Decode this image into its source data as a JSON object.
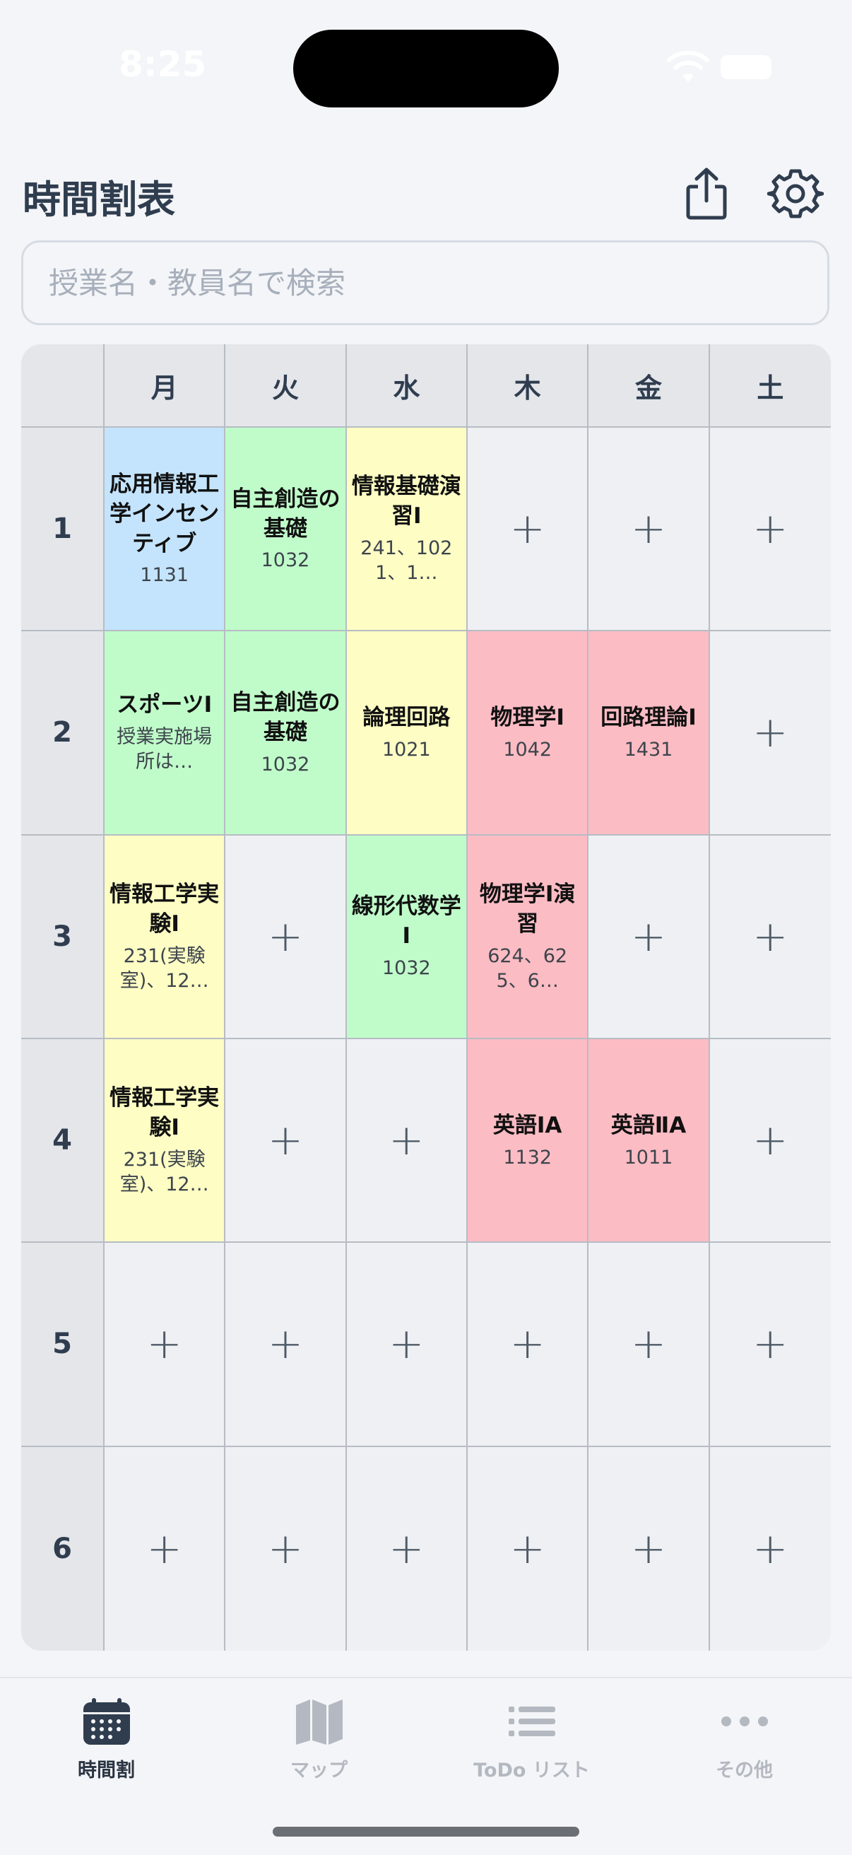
{
  "status_bar": {
    "time": "8:25"
  },
  "header": {
    "title": "時間割表"
  },
  "search": {
    "placeholder": "授業名・教員名で検索",
    "value": ""
  },
  "timetable": {
    "days": [
      "月",
      "火",
      "水",
      "木",
      "金",
      "土"
    ],
    "periods": [
      "1",
      "2",
      "3",
      "4",
      "5",
      "6"
    ],
    "add_symbol": "+",
    "slots": [
      [
        {
          "name": "応用情報工学インセンティブ",
          "room": "1131",
          "color": "#c4e4fd"
        },
        {
          "name": "自主創造の基礎",
          "room": "1032",
          "color": "#c0fcca"
        },
        {
          "name": "情報基礎演習Ⅰ",
          "room": "241、1021、1…",
          "color": "#fdfdc4"
        },
        null,
        null,
        null
      ],
      [
        {
          "name": "スポーツⅠ",
          "room": "授業実施場所は…",
          "color": "#c0fcca"
        },
        {
          "name": "自主創造の基礎",
          "room": "1032",
          "color": "#c0fcca"
        },
        {
          "name": "論理回路",
          "room": "1021",
          "color": "#fdfdc4"
        },
        {
          "name": "物理学Ⅰ",
          "room": "1042",
          "color": "#fcbcc4"
        },
        {
          "name": "回路理論Ⅰ",
          "room": "1431",
          "color": "#fcbcc4"
        },
        null
      ],
      [
        {
          "name": "情報工学実験Ⅰ",
          "room": "231(実験室)、12…",
          "color": "#fdfdc4"
        },
        null,
        {
          "name": "線形代数学Ⅰ",
          "room": "1032",
          "color": "#c0fcca"
        },
        {
          "name": "物理学Ⅰ演習",
          "room": "624、625、6…",
          "color": "#fcbcc4"
        },
        null,
        null
      ],
      [
        {
          "name": "情報工学実験Ⅰ",
          "room": "231(実験室)、12…",
          "color": "#fdfdc4"
        },
        null,
        null,
        {
          "name": "英語ⅠA",
          "room": "1132",
          "color": "#fcbcc4"
        },
        {
          "name": "英語ⅡA",
          "room": "1011",
          "color": "#fcbcc4"
        },
        null
      ],
      [
        null,
        null,
        null,
        null,
        null,
        null
      ],
      [
        null,
        null,
        null,
        null,
        null,
        null
      ]
    ]
  },
  "tab_bar": {
    "items": [
      {
        "label": "時間割",
        "icon": "calendar-icon",
        "active": true
      },
      {
        "label": "マップ",
        "icon": "map-icon",
        "active": false
      },
      {
        "label": "ToDo リスト",
        "icon": "list-icon",
        "active": false
      },
      {
        "label": "その他",
        "icon": "more-icon",
        "active": false
      }
    ]
  },
  "colors": {
    "accent_text": "#2f3d4f",
    "inactive_tab": "#b4b9c1",
    "course_blue": "#c4e4fd",
    "course_green": "#c0fcca",
    "course_yellow": "#fdfdc4",
    "course_pink": "#fcbcc4"
  }
}
